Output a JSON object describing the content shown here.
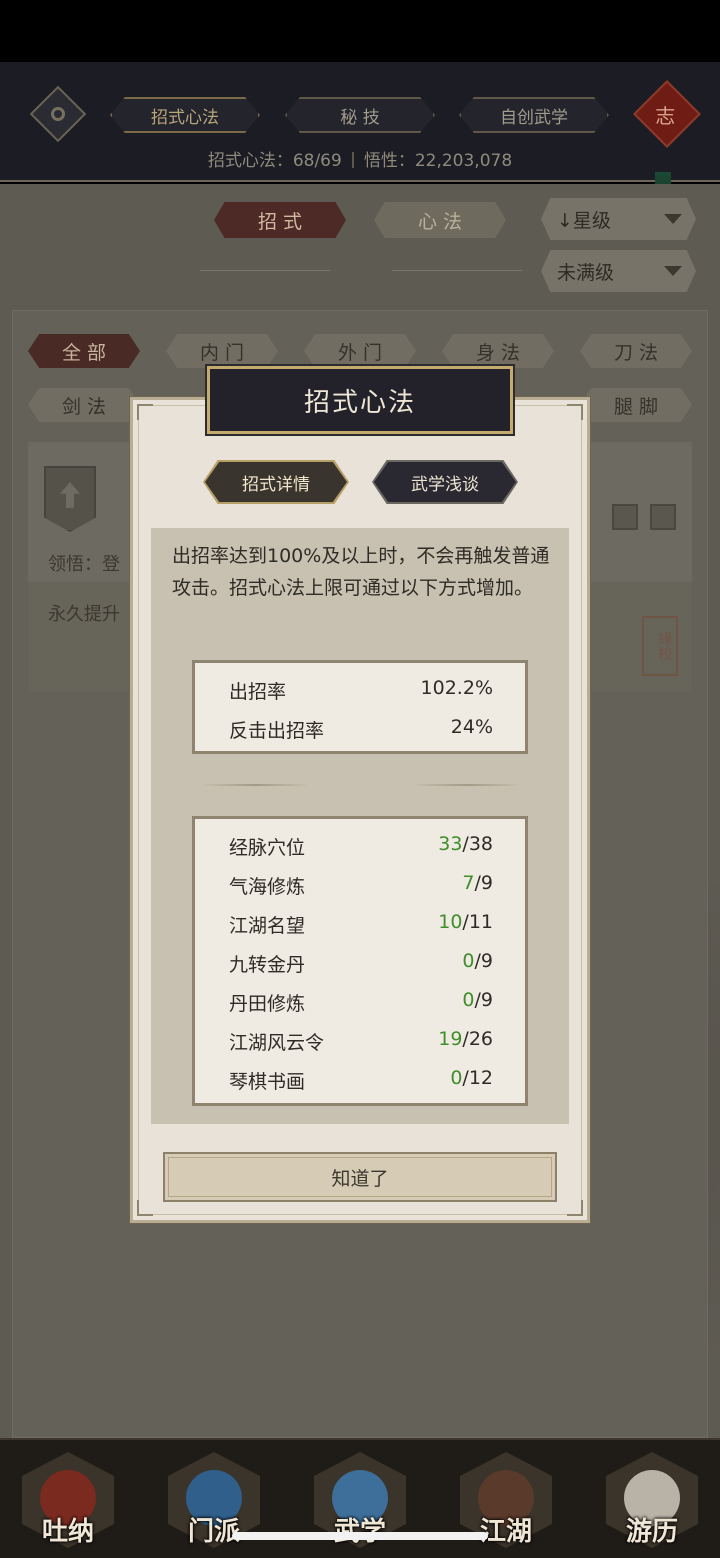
{
  "header": {
    "tabs": [
      {
        "label": "招式心法",
        "active": true
      },
      {
        "label": "秘 技",
        "active": false
      },
      {
        "label": "自创武学",
        "active": false
      }
    ],
    "knot_char": "志",
    "stats_left": "招式心法：68/69",
    "stats_right": "悟性：22,203,078"
  },
  "page": {
    "segment_tabs": [
      {
        "label": "招 式",
        "active": true
      },
      {
        "label": "心 法",
        "active": false
      }
    ],
    "sort_dropdown": "↓星级",
    "filter_dropdown": "未满级",
    "category_chips_row1": [
      "全 部",
      "内 门",
      "外 门",
      "身 法",
      "刀 法"
    ],
    "category_chips_row2": [
      "剑 法",
      "腿 脚"
    ],
    "card": {
      "comprehension_label": "领悟：登",
      "desc_text": "永久提升",
      "seal_text": "綠校"
    }
  },
  "modal": {
    "title": "招式心法",
    "tabs": [
      {
        "label": "招式详情",
        "active": true
      },
      {
        "label": "武学浅谈",
        "active": false
      }
    ],
    "description": "出招率达到100%及以上时，不会再触发普通攻击。招式心法上限可通过以下方式增加。",
    "rates": [
      {
        "name": "出招率",
        "value": "102.2%"
      },
      {
        "name": "反击出招率",
        "value": "24%"
      }
    ],
    "sources": [
      {
        "name": "经脉穴位",
        "current": "33",
        "max": "/38"
      },
      {
        "name": "气海修炼",
        "current": "7",
        "max": "/9"
      },
      {
        "name": "江湖名望",
        "current": "10",
        "max": "/11"
      },
      {
        "name": "九转金丹",
        "current": "0",
        "max": "/9"
      },
      {
        "name": "丹田修炼",
        "current": "0",
        "max": "/9"
      },
      {
        "name": "江湖风云令",
        "current": "19",
        "max": "/26"
      },
      {
        "name": "琴棋书画",
        "current": "0",
        "max": "/12"
      }
    ],
    "ok_label": "知道了"
  },
  "bottom_nav": [
    {
      "label": "吐纳",
      "icon": "meditating-figure-icon",
      "color": "#7a2a1e"
    },
    {
      "label": "门派",
      "icon": "sect-banner-icon",
      "color": "#2f5f8a"
    },
    {
      "label": "武学",
      "icon": "martial-manual-icon",
      "color": "#3d6f9a"
    },
    {
      "label": "江湖",
      "icon": "bamboo-hat-icon",
      "color": "#5a3a2a"
    },
    {
      "label": "游历",
      "icon": "white-horse-icon",
      "color": "#b9b2a6"
    }
  ]
}
